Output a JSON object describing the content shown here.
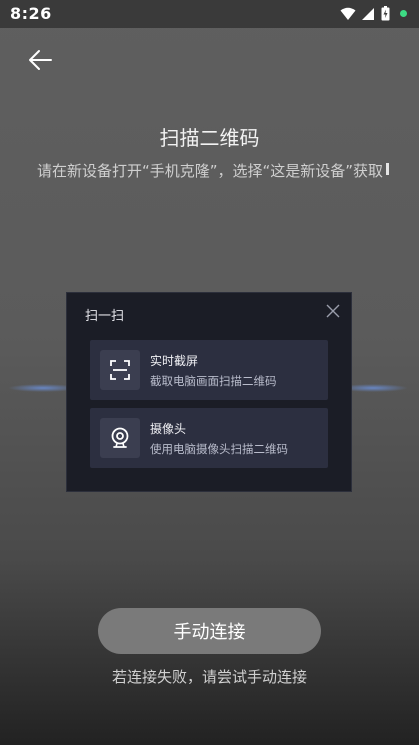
{
  "status_bar": {
    "time": "8:26",
    "icons": [
      "wifi-icon",
      "signal-icon",
      "battery-icon",
      "notification-dot"
    ],
    "dot_color": "#3ddc84"
  },
  "header": {
    "back_icon": "back-arrow-icon"
  },
  "main": {
    "title": "扫描二维码",
    "description": "请在新设备打开“手机克隆”，选择“这是新设备”获取扫描二维码"
  },
  "dialog": {
    "title": "扫一扫",
    "close_icon": "close-icon",
    "options": [
      {
        "icon": "screenshot-frame-icon",
        "title": "实时截屏",
        "subtitle": "截取电脑画面扫描二维码"
      },
      {
        "icon": "webcam-icon",
        "title": "摄像头",
        "subtitle": "使用电脑摄像头扫描二维码"
      }
    ]
  },
  "footer": {
    "manual_button": "手动连接",
    "hint": "若连接失败，请尝试手动连接"
  },
  "colors": {
    "dialog_bg": "#1b1d26",
    "option_bg": "#2c2f40",
    "button_bg": "#7a7a7a"
  }
}
